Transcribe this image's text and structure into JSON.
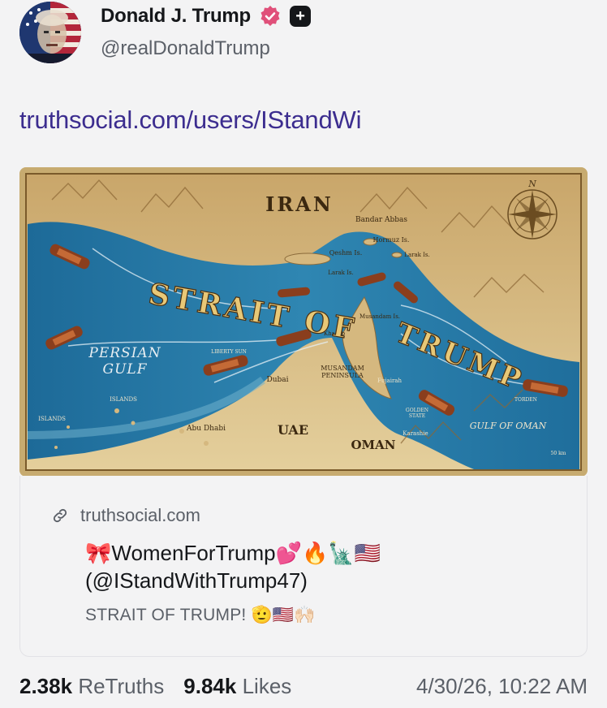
{
  "post": {
    "author": {
      "display_name": "Donald J. Trump",
      "handle": "@realDonaldTrump",
      "verified": true,
      "icons": [
        "avatar",
        "verified-badge-icon",
        "plus-badge-icon"
      ]
    },
    "link_text": "truthsocial.com/users/IStandWi",
    "image": {
      "labels": {
        "iran": "IRAN",
        "bandar_abbas": "Bandar Abbas",
        "hormuz": "Hormuz Is.",
        "qeshm": "Qeshm Is.",
        "larak_east": "Larak Is.",
        "larak": "Larak Is.",
        "musandam_is": "Musandam Is.",
        "khasab": "Khasab",
        "strait_of": "STRAIT OF",
        "trump": "TRUMP",
        "persian": "PERSIAN",
        "gulf": "GULF",
        "liberty_sun": "LIBERTY SUN",
        "dubai": "Dubai",
        "musandam_peninsula_1": "MUSANDAM",
        "musandam_peninsula_2": "PENINSULA",
        "fujairah": "Fujairah",
        "islands_left": "ISLANDS",
        "islands_mid": "ISLANDS",
        "abu_dhabi": "Abu Dhabi",
        "uae": "UAE",
        "golden_state_1": "GOLDEN",
        "golden_state_2": "STATE",
        "oman": "OMAN",
        "karashie": "Karashie",
        "gulf_of_oman": "GULF OF OMAN",
        "torden": "TORDEN",
        "compass_n": "N",
        "scale": "50 km"
      },
      "colors": {
        "land": "#d9c08a",
        "water": "#2a78a4",
        "water_deep": "#13507a",
        "title_gold": "#e8c877",
        "frame": "#c7ab70"
      }
    },
    "card": {
      "domain": "truthsocial.com",
      "title_line1": "🎀WomenForTrump💕🔥🗽🇺🇸",
      "title_line2": "(@IStandWithTrump47)",
      "description": "STRAIT OF TRUMP! 🫡🇺🇸🙌🏻",
      "icon": "link-icon"
    },
    "stats": {
      "retruths_count": "2.38k",
      "retruths_label": "ReTruths",
      "likes_count": "9.84k",
      "likes_label": "Likes",
      "timestamp": "4/30/26, 10:22 AM"
    }
  }
}
